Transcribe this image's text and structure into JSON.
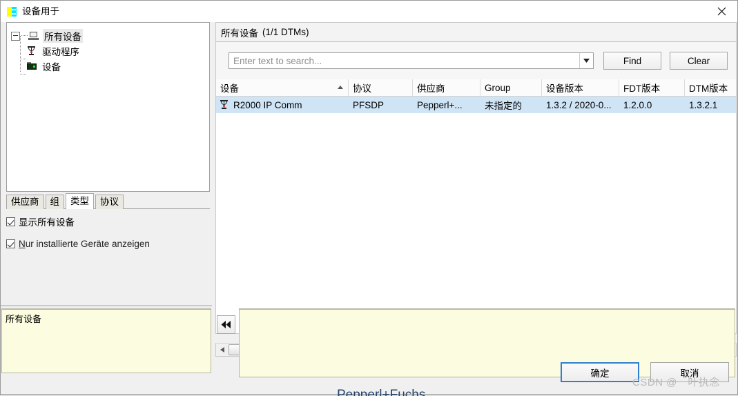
{
  "window": {
    "title": "设备用于",
    "icon": "app-icon",
    "close_label": "×"
  },
  "tree": {
    "nodes": [
      {
        "label": "所有设备",
        "icon": "computer-icon",
        "selected": true
      },
      {
        "label": "驱动程序",
        "icon": "dtm-icon",
        "selected": false
      },
      {
        "label": "设备",
        "icon": "device-icon",
        "selected": false
      }
    ]
  },
  "tabs": [
    {
      "label": "供应商",
      "active": false
    },
    {
      "label": "组",
      "active": false
    },
    {
      "label": "类型",
      "active": true
    },
    {
      "label": "协议",
      "active": false
    }
  ],
  "checkboxes": [
    {
      "label": "显示所有设备",
      "checked": true,
      "accel": ""
    },
    {
      "label": "Nur installierte Geräte anzeigen",
      "checked": true,
      "accel": "N"
    }
  ],
  "left_info": {
    "text": "所有设备"
  },
  "right": {
    "header_main": "所有设备",
    "header_sub": "(1/1 DTMs)",
    "search": {
      "placeholder": "Enter text to search...",
      "value": "",
      "dropdown_icon": "chevron-down-icon"
    },
    "find_label": "Find",
    "clear_label": "Clear"
  },
  "table": {
    "columns": [
      {
        "label": "设备",
        "width": 192,
        "sorted": true,
        "sort_dir": "asc"
      },
      {
        "label": "协议",
        "width": 93,
        "sorted": false
      },
      {
        "label": "供应商",
        "width": 98,
        "sorted": false
      },
      {
        "label": "Group",
        "width": 89,
        "sorted": false
      },
      {
        "label": "设备版本",
        "width": 112,
        "sorted": false
      },
      {
        "label": "FDT版本",
        "width": 95,
        "sorted": false
      },
      {
        "label": "DTM版本",
        "width": 78,
        "sorted": false
      }
    ],
    "rows": [
      {
        "selected": true,
        "icon": "dtm-icon",
        "cells": [
          "R2000 IP Comm",
          "PFSDP",
          "Pepperl+...",
          "未指定的",
          "1.3.2 / 2020-0...",
          "1.2.0.0",
          "1.3.2.1"
        ]
      }
    ]
  },
  "scrollbar": {
    "left_arrow": "◀",
    "right_arrow": "▶",
    "grip": "scrollbar-grip"
  },
  "collapse": {
    "label": "◀◀"
  },
  "right_info": {
    "text": ""
  },
  "footer": {
    "ok_label": "确定",
    "cancel_label": "取消"
  },
  "watermark": {
    "text": "CSDN @一叶执念"
  },
  "bleed": {
    "text": "Pepperl+Fuchs"
  },
  "colors": {
    "selection_blue": "#cfe4f5",
    "focus_border": "#2f7fd0",
    "info_yellow": "#fcfce0",
    "window_bg": "#f0f0f0",
    "icon_yellow": "#ffff00",
    "icon_cyan": "#00e5ff"
  }
}
